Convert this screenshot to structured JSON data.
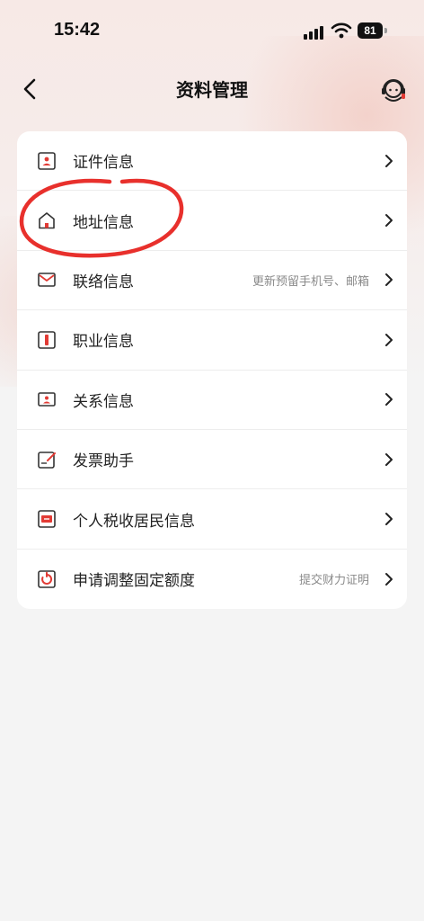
{
  "status_bar": {
    "time": "15:42",
    "battery": "81",
    "icons": [
      "signal-icon",
      "wifi-icon",
      "battery-icon"
    ]
  },
  "nav": {
    "title": "资料管理",
    "back_icon": "chevron-left-icon",
    "service_icon": "customer-service-icon"
  },
  "menu": {
    "items": [
      {
        "label": "证件信息",
        "sub": "",
        "icon": "id-card-icon"
      },
      {
        "label": "地址信息",
        "sub": "",
        "icon": "home-icon"
      },
      {
        "label": "联络信息",
        "sub": "更新预留手机号、邮箱",
        "icon": "mail-icon"
      },
      {
        "label": "职业信息",
        "sub": "",
        "icon": "briefcase-icon"
      },
      {
        "label": "关系信息",
        "sub": "",
        "icon": "contact-card-icon"
      },
      {
        "label": "发票助手",
        "sub": "",
        "icon": "invoice-icon"
      },
      {
        "label": "个人税收居民信息",
        "sub": "",
        "icon": "tax-icon"
      },
      {
        "label": "申请调整固定额度",
        "sub": "提交财力证明",
        "icon": "limit-gauge-icon"
      }
    ]
  },
  "colors": {
    "accent": "#e23b35",
    "annotation": "#e8302c",
    "background": "#f4f4f4"
  }
}
